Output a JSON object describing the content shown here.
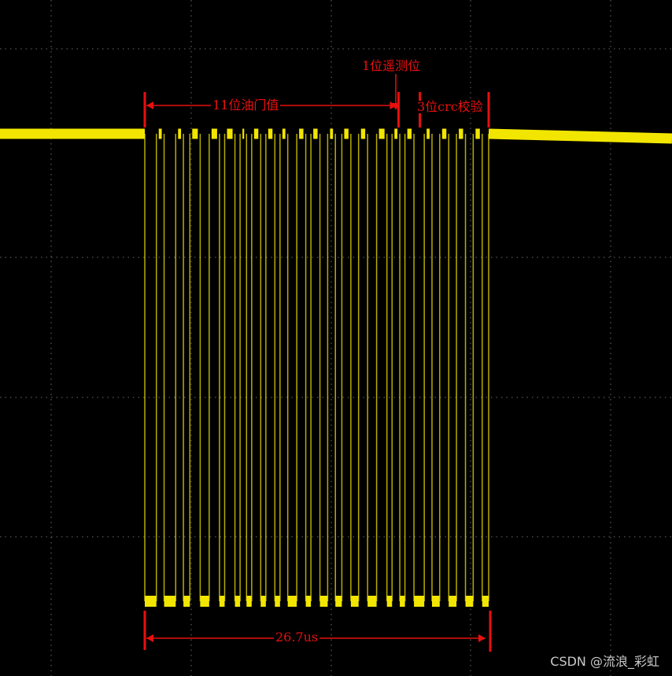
{
  "chart_data": {
    "type": "line",
    "signal_color": "#f2e600",
    "annotation_color": "#e8100e",
    "grid": true,
    "grid_color": "#7a7a7a",
    "background": "#000000",
    "levels": {
      "high": 1,
      "low": 0
    },
    "timeline": {
      "total": 26.7,
      "unit": "us",
      "bit_groups": [
        {
          "label": "11位油门值",
          "bits": 11
        },
        {
          "label": "1位遥测位",
          "bits": 1
        },
        {
          "label": "3位crc校验",
          "bits": 3
        }
      ]
    },
    "waveform": {
      "low_pulse_bounds": [
        [
          0,
          0.9
        ],
        [
          1.5,
          2.4
        ],
        [
          3.0,
          3.5
        ],
        [
          4.3,
          5.0
        ],
        [
          5.8,
          6.2
        ],
        [
          7.0,
          7.4
        ],
        [
          7.9,
          8.3
        ],
        [
          9.0,
          9.4
        ],
        [
          10.1,
          10.5
        ],
        [
          11.1,
          11.8
        ],
        [
          12.5,
          12.9
        ],
        [
          13.6,
          14.2
        ],
        [
          14.8,
          15.3
        ],
        [
          16.0,
          16.6
        ],
        [
          17.3,
          18.0
        ],
        [
          18.8,
          19.2
        ],
        [
          19.8,
          20.2
        ],
        [
          20.9,
          21.7
        ],
        [
          22.3,
          22.9
        ],
        [
          23.6,
          24.2
        ],
        [
          24.9,
          25.5
        ],
        [
          26.2,
          26.7
        ]
      ]
    },
    "annotations": {
      "throttle": "11位油门值",
      "telemetry": "1位遥测位",
      "crc": "3位crc校验",
      "duration": "26.7us"
    }
  },
  "watermark": "CSDN @流浪_彩虹"
}
